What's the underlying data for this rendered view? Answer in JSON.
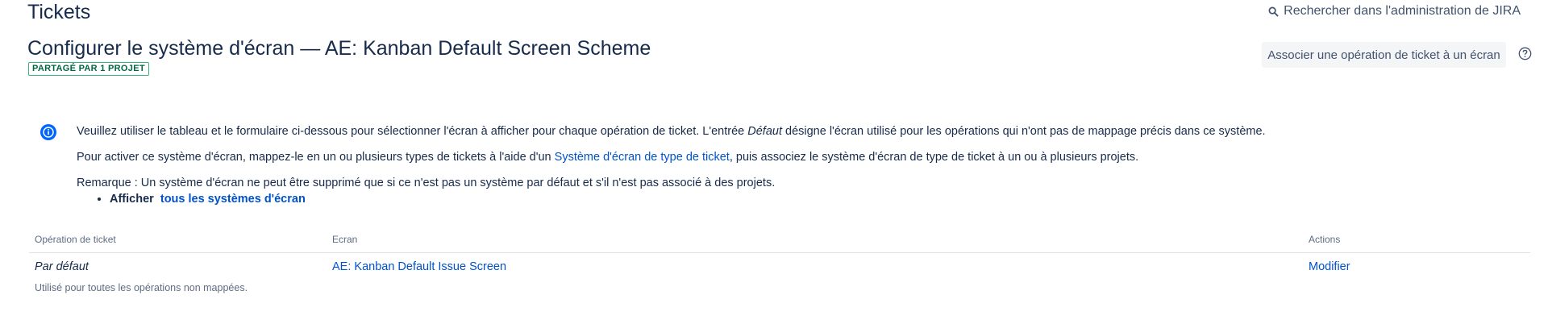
{
  "header": {
    "title": "Tickets",
    "admin_search_label": "Rechercher dans l'administration de JIRA"
  },
  "scheme": {
    "title": "Configurer le système d'écran — AE: Kanban Default Screen Scheme",
    "shared_badge": "PARTAGÉ PAR 1 PROJET",
    "associate_button": "Associer une opération de ticket à un écran"
  },
  "info": {
    "p1_before": "Veuillez utiliser le tableau et le formulaire ci-dessous pour sélectionner l'écran à afficher pour chaque opération de ticket. L'entrée ",
    "p1_em": "Défaut",
    "p1_after": " désigne l'écran utilisé pour les opérations qui n'ont pas de mappage précis dans ce système.",
    "p2_before": "Pour activer ce système d'écran, mappez-le en un ou plusieurs types de tickets à l'aide d'un ",
    "p2_link": "Système d'écran de type de ticket",
    "p2_after": ", puis associez le système d'écran de type de ticket à un ou à plusieurs projets.",
    "p3": "Remarque : Un système d'écran ne peut être supprimé que si ce n'est pas un système par défaut et s'il n'est pas associé à des projets.",
    "list_label": "Afficher",
    "list_link": "tous les systèmes d'écran"
  },
  "table": {
    "headers": [
      "Opération de ticket",
      "Ecran",
      "Actions"
    ],
    "rows": [
      {
        "operation": "Par défaut",
        "description": "Utilisé pour toutes les opérations non mappées.",
        "screen": "AE: Kanban Default Issue Screen",
        "action": "Modifier"
      }
    ]
  },
  "colors": {
    "text": "#172b4d",
    "link": "#0052cc",
    "badge_border": "#36b37e",
    "badge_text": "#006644",
    "info_icon": "#0065ff"
  },
  "icons": {
    "search": "search-icon",
    "help": "help-icon",
    "info": "info-icon"
  }
}
